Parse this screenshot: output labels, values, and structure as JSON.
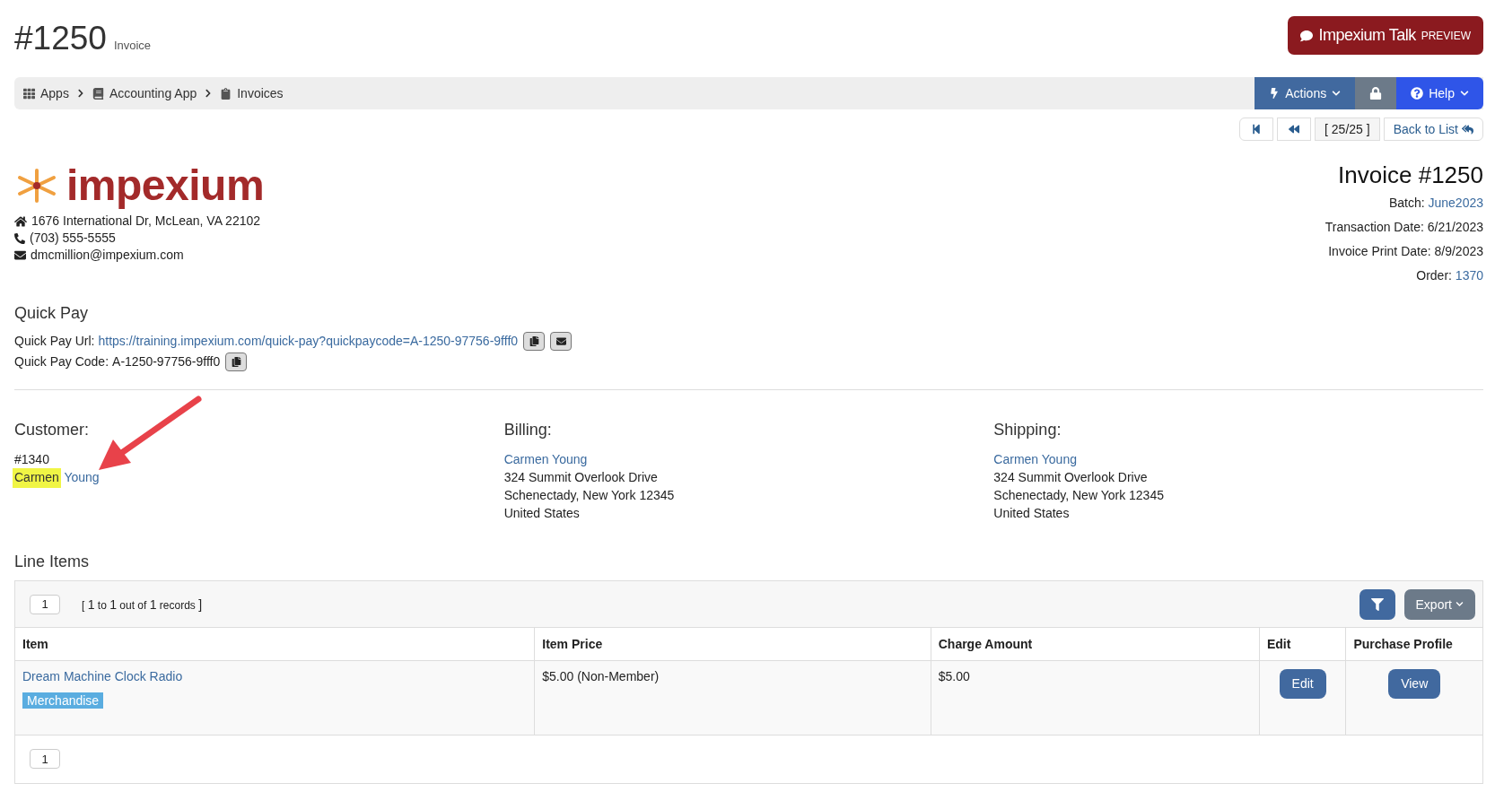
{
  "header": {
    "title": "#1250",
    "subtitle": "Invoice",
    "talk_button": {
      "label": "Impexium Talk",
      "tag": "PREVIEW"
    }
  },
  "breadcrumb": [
    {
      "label": "Apps"
    },
    {
      "label": "Accounting App"
    },
    {
      "label": "Invoices"
    }
  ],
  "toolbar": {
    "actions": "Actions",
    "help": "Help"
  },
  "pager": {
    "position": "[ 25/25 ]",
    "back": "Back to List"
  },
  "company": {
    "logo_text": "impexium",
    "address": "1676 International Dr, McLean, VA 22102",
    "phone": "(703) 555-5555",
    "email": "dmcmillion@impexium.com"
  },
  "invoice": {
    "title": "Invoice #1250",
    "details": [
      {
        "label": "Batch:",
        "value": "June2023",
        "link": true
      },
      {
        "label": "Transaction Date:",
        "value": "6/21/2023",
        "link": false
      },
      {
        "label": "Invoice Print Date:",
        "value": "8/9/2023",
        "link": false
      },
      {
        "label": "Order:",
        "value": "1370",
        "link": true
      }
    ]
  },
  "quick_pay": {
    "heading": "Quick Pay",
    "url_label": "Quick Pay Url:",
    "url": "https://training.impexium.com/quick-pay?quickpaycode=A-1250-97756-9fff0",
    "code_label": "Quick Pay Code:",
    "code": "A-1250-97756-9fff0"
  },
  "customer": {
    "heading": "Customer:",
    "number": "#1340",
    "name_highlighted": "Carmen",
    "name_rest": "Young"
  },
  "billing": {
    "heading": "Billing:",
    "name": "Carmen Young",
    "lines": [
      "324 Summit Overlook Drive",
      "Schenectady, New York 12345",
      "United States"
    ]
  },
  "shipping": {
    "heading": "Shipping:",
    "name": "Carmen Young",
    "lines": [
      "324 Summit Overlook Drive",
      "Schenectady, New York 12345",
      "United States"
    ]
  },
  "line_items": {
    "heading": "Line Items",
    "page": "1",
    "records": {
      "open": "[",
      "from": "1",
      "to_word": "to",
      "to": "1",
      "out_of": "out of",
      "total": "1",
      "word": "records",
      "close": "]"
    },
    "export": "Export",
    "footer_page": "1",
    "columns": [
      "Item",
      "Item Price",
      "Charge Amount",
      "Edit",
      "Purchase Profile"
    ],
    "rows": [
      {
        "item": "Dream Machine Clock Radio",
        "tag": "Merchandise",
        "price": "$5.00 (Non-Member)",
        "charge": "$5.00",
        "edit": "Edit",
        "profile": "View"
      }
    ]
  }
}
